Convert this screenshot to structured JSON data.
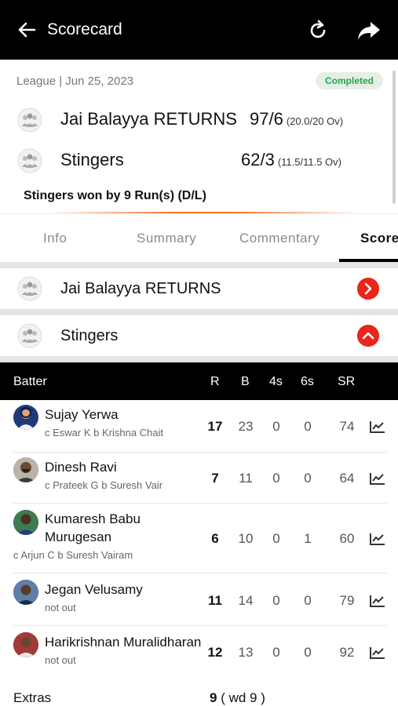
{
  "header": {
    "title": "Scorecard"
  },
  "match": {
    "meta": "League | Jun 25, 2023",
    "status": "Completed",
    "teams": [
      {
        "name": "Jai Balayya RETURNS",
        "score": "97/6",
        "overs": "(20.0/20 Ov)"
      },
      {
        "name": "Stingers",
        "score": "62/3",
        "overs": "(11.5/11.5 Ov)"
      }
    ],
    "result": "Stingers won by 9 Run(s) (D/L)"
  },
  "tabs": [
    "Info",
    "Summary",
    "Commentary",
    "Scorecard"
  ],
  "innings": [
    {
      "name": "Jai Balayya RETURNS",
      "expanded": false
    },
    {
      "name": "Stingers",
      "expanded": true
    }
  ],
  "batting": {
    "headers": {
      "batter": "Batter",
      "r": "R",
      "b": "B",
      "fours": "4s",
      "sixes": "6s",
      "sr": "SR"
    },
    "rows": [
      {
        "name": "Sujay Yerwa",
        "dismissal": "c Eswar K b Krishna Chait",
        "r": "17",
        "b": "23",
        "fours": "0",
        "sixes": "0",
        "sr": "74"
      },
      {
        "name": "Dinesh Ravi",
        "dismissal": "c Prateek G b Suresh Vair",
        "r": "7",
        "b": "11",
        "fours": "0",
        "sixes": "0",
        "sr": "64"
      },
      {
        "name": "Kumaresh Babu",
        "name2": "Murugesan",
        "dismissal": "c Arjun C b Suresh Vairam",
        "r": "6",
        "b": "10",
        "fours": "0",
        "sixes": "1",
        "sr": "60"
      },
      {
        "name": "Jegan Velusamy",
        "dismissal": "not out",
        "r": "11",
        "b": "14",
        "fours": "0",
        "sixes": "0",
        "sr": "79"
      },
      {
        "name": "Harikrishnan Muralidharan",
        "dismissal": "not out",
        "r": "12",
        "b": "13",
        "fours": "0",
        "sixes": "0",
        "sr": "92"
      }
    ],
    "extras": {
      "label": "Extras",
      "total": "9",
      "detail": "( wd 9 )"
    }
  },
  "colors": {
    "accent": "#e8261c",
    "completed": "#20a84a",
    "header_bg": "#000000"
  }
}
